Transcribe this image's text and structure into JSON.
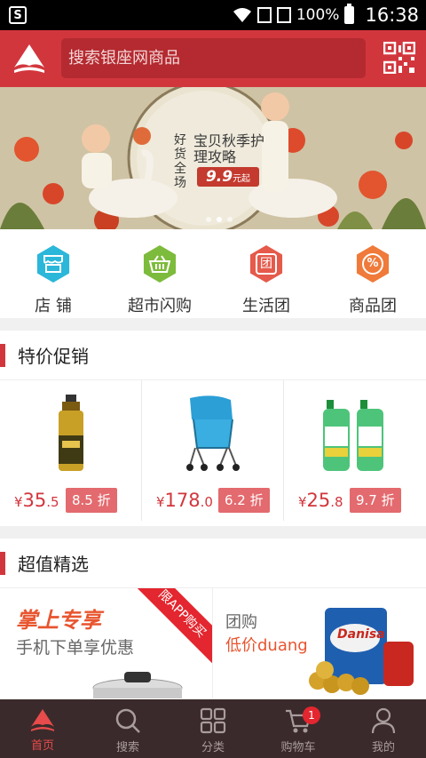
{
  "status_bar": {
    "app_icon_letter": "S",
    "battery": "100%",
    "time": "16:38"
  },
  "header": {
    "search_placeholder": "搜索银座网商品",
    "brand_color": "#d2363d"
  },
  "banner": {
    "text_main": "宝贝秋季护理攻略",
    "price_tag": "9.9",
    "price_suffix": "元起",
    "side_text": "好货全场",
    "slide_count": 3,
    "active_slide": 2
  },
  "quick_nav": [
    {
      "label": "店 铺",
      "icon": "store-icon",
      "color": "#2ab7d9"
    },
    {
      "label": "超市闪购",
      "icon": "basket-icon",
      "color": "#7dbb3c"
    },
    {
      "label": "生活团",
      "icon": "group-icon",
      "color": "#e55a4b"
    },
    {
      "label": "商品团",
      "icon": "percent-icon",
      "color": "#f07a3a"
    }
  ],
  "specials": {
    "title": "特价促销",
    "items": [
      {
        "currency": "¥",
        "price_int": "35",
        "price_dec": ".5",
        "discount": "8.5 折",
        "image": "cooking-oil-bottle"
      },
      {
        "currency": "¥",
        "price_int": "178",
        "price_dec": ".0",
        "discount": "6.2 折",
        "image": "baby-stroller"
      },
      {
        "currency": "¥",
        "price_int": "25",
        "price_dec": ".8",
        "discount": "9.7 折",
        "image": "detergent-bottles"
      }
    ]
  },
  "selection": {
    "title": "超值精选",
    "left": {
      "headline": "掌上专享",
      "subline": "手机下单享优惠",
      "ribbon": "限APP购买"
    },
    "right": {
      "headline": "团购",
      "subline": "低价duang",
      "brand": "Danisa"
    }
  },
  "tabbar": [
    {
      "label": "首页",
      "icon": "home-icon",
      "active": true
    },
    {
      "label": "搜索",
      "icon": "search-icon",
      "active": false
    },
    {
      "label": "分类",
      "icon": "category-grid-icon",
      "active": false
    },
    {
      "label": "购物车",
      "icon": "cart-icon",
      "active": false,
      "badge": "1"
    },
    {
      "label": "我的",
      "icon": "profile-icon",
      "active": false
    }
  ]
}
